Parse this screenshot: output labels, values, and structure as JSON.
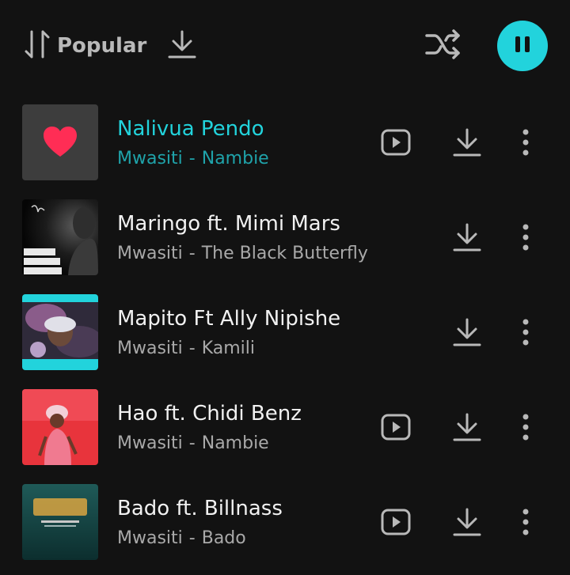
{
  "toolbar": {
    "sort_label": "Popular",
    "sort_icon": "sort-icon",
    "download_icon": "download-icon",
    "shuffle_icon": "shuffle-icon",
    "pause_icon": "pause-icon"
  },
  "colors": {
    "accent": "#22d3dc",
    "accent_dim": "#1fa3aa",
    "background": "#121212",
    "text_primary": "#f1f1f1",
    "text_secondary": "#a9a9a9",
    "heart": "#ff2d55"
  },
  "tracks": [
    {
      "title": "Nalivua Pendo",
      "artist": "Mwasiti",
      "separator": "-",
      "album": "Nambie",
      "thumb": "heart-placeholder",
      "has_video": true,
      "active": true
    },
    {
      "title": "Maringo ft. Mimi Mars",
      "artist": "Mwasiti",
      "separator": "-",
      "album": "The Black Butterfly",
      "thumb": "album-art-black-butterfly",
      "has_video": false,
      "active": false
    },
    {
      "title": "Mapito Ft Ally Nipishe",
      "artist": "Mwasiti",
      "separator": "-",
      "album": "Kamili",
      "thumb": "album-art-kamili",
      "has_video": false,
      "active": false
    },
    {
      "title": "Hao ft. Chidi Benz",
      "artist": "Mwasiti",
      "separator": "-",
      "album": "Nambie",
      "thumb": "album-art-nambie",
      "has_video": true,
      "active": false
    },
    {
      "title": "Bado ft. Billnass",
      "artist": "Mwasiti",
      "separator": "-",
      "album": "Bado",
      "thumb": "album-art-bado",
      "has_video": true,
      "active": false
    }
  ]
}
